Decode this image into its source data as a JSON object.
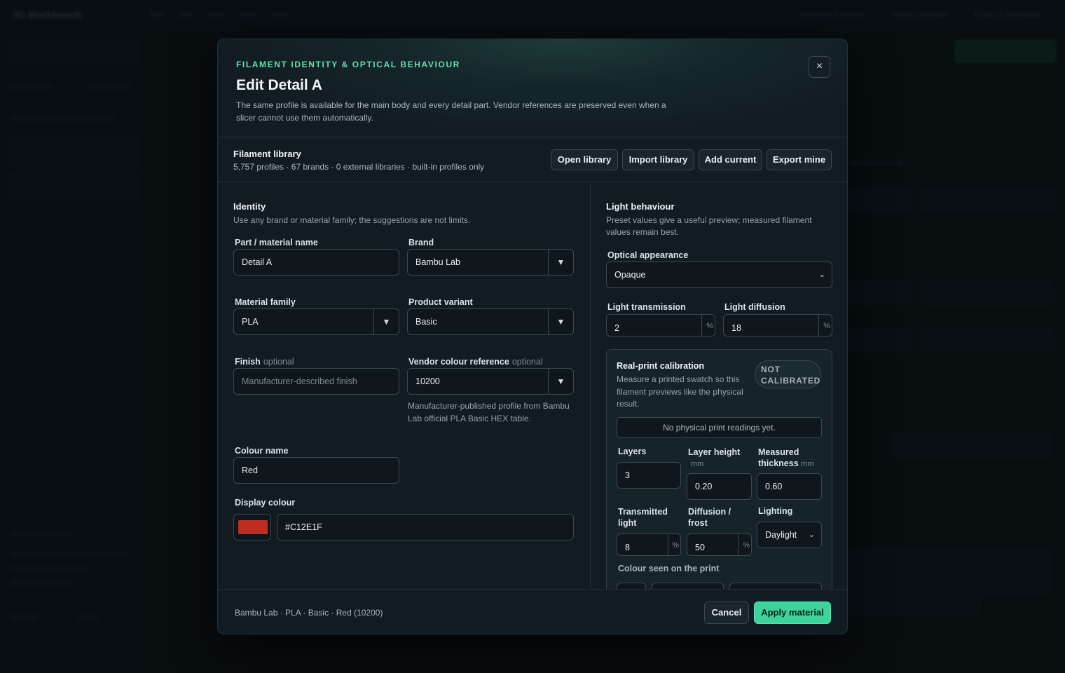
{
  "background": {
    "brand": "3D Workbench",
    "menu": [
      "File",
      "Edit",
      "View",
      "Tools",
      "Help"
    ],
    "right_links": [
      "Workflow Assistant",
      "Recent changes",
      "Export & Download"
    ]
  },
  "modal": {
    "eyebrow": "FILAMENT IDENTITY & OPTICAL BEHAVIOUR",
    "title": "Edit Detail A",
    "description": "The same profile is available for the main body and every detail part. Vendor references are preserved even when a slicer cannot use them automatically.",
    "close_label": "×"
  },
  "library": {
    "title": "Filament library",
    "summary": "5,757 profiles · 67 brands · 0 external libraries · built-in profiles only",
    "buttons": {
      "open": "Open library",
      "import": "Import library",
      "add": "Add current",
      "export": "Export mine"
    }
  },
  "identity": {
    "title": "Identity",
    "subtitle": "Use any brand or material family; the suggestions are not limits.",
    "part_name_label": "Part / material name",
    "part_name_value": "Detail A",
    "brand_label": "Brand",
    "brand_value": "Bambu Lab",
    "family_label": "Material family",
    "family_value": "PLA",
    "variant_label": "Product variant",
    "variant_value": "Basic",
    "finish_label": "Finish",
    "finish_optional": "optional",
    "finish_placeholder": "Manufacturer-described finish",
    "vendor_ref_label": "Vendor colour reference",
    "vendor_ref_optional": "optional",
    "vendor_ref_value": "10200",
    "vendor_ref_helper": "Manufacturer-published profile from Bambu Lab official PLA Basic HEX table.",
    "colour_name_label": "Colour name",
    "colour_name_value": "Red",
    "display_colour_label": "Display colour",
    "display_colour_hex": "#C12E1F",
    "swatch_color": "#c12e1f",
    "dropdown_arrow": "▼"
  },
  "light": {
    "title": "Light behaviour",
    "subtitle": "Preset values give a useful preview; measured filament values remain best.",
    "optical_label": "Optical appearance",
    "optical_value": "Opaque",
    "transmission_label": "Light transmission",
    "transmission_value": "2",
    "diffusion_label": "Light diffusion",
    "diffusion_value": "18",
    "percent": "%"
  },
  "calibration": {
    "title": "Real-print calibration",
    "subtitle": "Measure a printed swatch so this filament previews like the physical result.",
    "badge": "NOT CALIBRATED",
    "empty_readings": "No physical print readings yet.",
    "layers_label": "Layers",
    "layers_value": "3",
    "layer_height_label": "Layer height",
    "layer_height_unit": "mm",
    "layer_height_value": "0.20",
    "thickness_label": "Measured thickness",
    "thickness_unit": "mm",
    "thickness_value": "0.60",
    "transmitted_label": "Transmitted light",
    "transmitted_value": "8",
    "frost_label": "Diffusion / frost",
    "frost_value": "50",
    "lighting_label": "Lighting",
    "lighting_value": "Daylight",
    "colour_seen_label": "Colour seen on the print"
  },
  "footer": {
    "summary": "Bambu Lab · PLA · Basic · Red (10200)",
    "cancel": "Cancel",
    "apply": "Apply material"
  }
}
